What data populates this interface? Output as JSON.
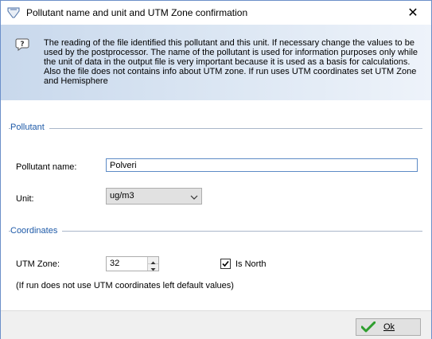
{
  "window": {
    "title": "Pollutant name and unit and UTM Zone confirmation",
    "close_glyph": "✕"
  },
  "info": {
    "icon": "info-bubble-icon",
    "text": "The reading of the file identified this pollutant and this unit. If necessary change the values to be used by the postprocessor. The name of the pollutant is used for information purposes only while the unit of data in the output file is very important because it is used as a basis for calculations. Also the file does not contains info about UTM zone. If run uses UTM coordinates set UTM Zone and Hemisphere"
  },
  "pollutant": {
    "group_title": "Pollutant",
    "name_label": "Pollutant name:",
    "name_value": "Polveri",
    "unit_label": "Unit:",
    "unit_value": "ug/m3"
  },
  "coordinates": {
    "group_title": "Coordinates",
    "utm_zone_label": "UTM Zone:",
    "utm_zone_value": "32",
    "is_north_label": "Is North",
    "is_north_checked": true,
    "note": "(If run does not use UTM coordinates left default values)"
  },
  "footer": {
    "ok_label": "Ok"
  },
  "colors": {
    "group_title": "#1e5aa8",
    "banner_start": "#c8d8ec",
    "ok_check": "#2e9e2e"
  }
}
